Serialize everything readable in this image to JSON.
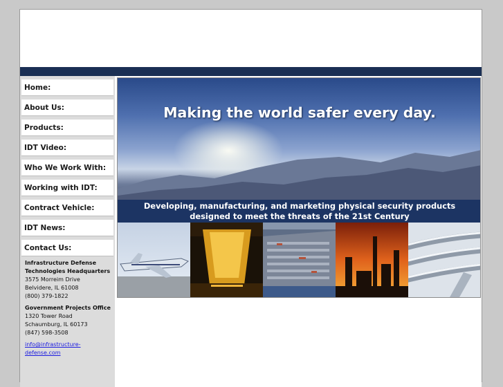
{
  "nav": {
    "items": [
      {
        "label": "Home:"
      },
      {
        "label": "About Us:"
      },
      {
        "label": "Products:"
      },
      {
        "label": "IDT Video:"
      },
      {
        "label": "Who We Work With:"
      },
      {
        "label": "Working with IDT:"
      },
      {
        "label": "Contract Vehicle:"
      },
      {
        "label": "IDT News:"
      },
      {
        "label": "Contact Us:"
      }
    ]
  },
  "contact": {
    "hq": {
      "name_line1": "Infrastructure Defense",
      "name_line2": "Technologies Headquarters",
      "street": "3575 Morreim Drive",
      "city": "Belvidere, IL 61008",
      "phone": "(800) 379-1822"
    },
    "gov": {
      "name": "Government Projects Office",
      "street": "1320 Tower Road",
      "city": "Schaumburg, IL 60173",
      "phone": "(847) 598-3508"
    },
    "email_line1": "info@infrastructure-",
    "email_line2": "defense.com"
  },
  "banner": {
    "headline": "Making the world safer every day.",
    "tagline_line1": "Developing, manufacturing, and marketing physical security products",
    "tagline_line2": "designed to meet the threats of the 21st Century"
  },
  "colors": {
    "navy": "#1a2f54",
    "tagline_band": "#1c3463",
    "link": "#1a1ae0",
    "sidebar": "#dcdcdc"
  },
  "photos": [
    {
      "icon": "airplane-icon"
    },
    {
      "icon": "dam-icon"
    },
    {
      "icon": "port-icon"
    },
    {
      "icon": "refinery-icon"
    },
    {
      "icon": "pipeline-icon"
    }
  ]
}
